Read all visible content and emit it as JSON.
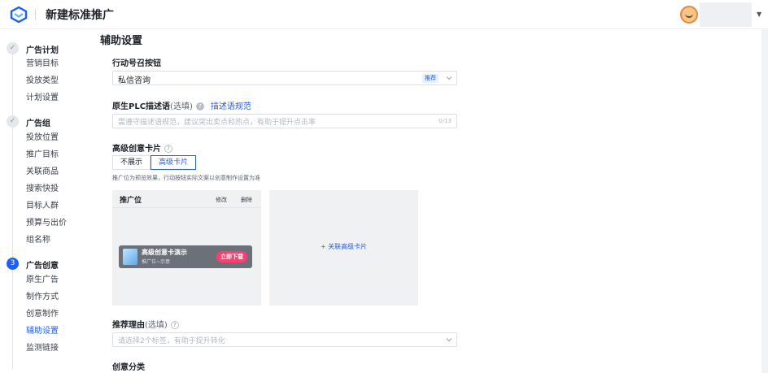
{
  "header": {
    "title": "新建标准推广"
  },
  "sidebar": {
    "sections": [
      {
        "badge": "✓",
        "label": "广告计划",
        "items": [
          "营销目标",
          "投放类型",
          "计划设置"
        ]
      },
      {
        "badge": "✓",
        "label": "广告组",
        "items": [
          "投放位置",
          "推广目标",
          "关联商品",
          "搜索快投",
          "目标人群",
          "预算与出价",
          "组名称"
        ]
      },
      {
        "badge": "3",
        "label": "广告创意",
        "items": [
          "原生广告",
          "制作方式",
          "创意制作",
          "辅助设置",
          "监测链接"
        ]
      }
    ],
    "active_item": "辅助设置"
  },
  "main": {
    "title": "辅助设置",
    "cta": {
      "label": "行动号召按钮",
      "value": "私信咨询",
      "tag": "推荐"
    },
    "plc": {
      "label": "原生PLC描述语",
      "optional": "(选填)",
      "help": "?",
      "link": "描述语规范",
      "placeholder": "需遵守描述语规范，建议突出卖点和热点，有助于提升点击率",
      "counter": "0/13"
    },
    "card": {
      "label": "高级创意卡片",
      "help": "?",
      "options": [
        "不展示",
        "高级卡片"
      ],
      "selected": "高级卡片",
      "note": "推广位为预览效果，行动按钮实际文案以创意制作设置为准",
      "preview": {
        "title": "推广位",
        "edit": "修改",
        "delete": "删除",
        "card_title": "高级创意卡演示",
        "card_sub": "推广位~示意",
        "card_button": "立即下载"
      },
      "add_label": "+ 关联高级卡片"
    },
    "reason": {
      "label": "推荐理由",
      "optional": "(选填)",
      "help": "?",
      "placeholder": "请选择2个标签，有助于提升转化"
    },
    "category": {
      "label": "创意分类"
    }
  },
  "colors": {
    "accent": "#1e5eff",
    "cta_button": "#ff3d6f"
  }
}
